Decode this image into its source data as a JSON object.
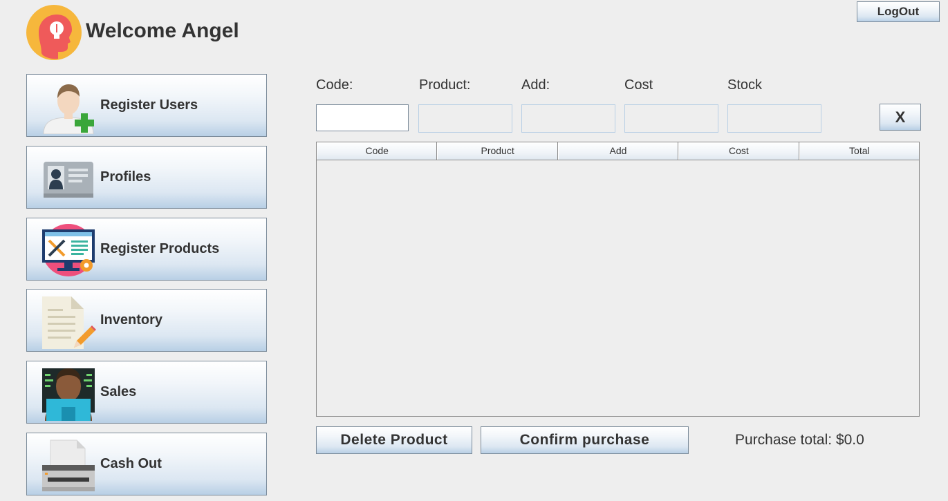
{
  "header": {
    "welcome": "Welcome Angel",
    "logout_label": "LogOut",
    "avatar_icon": "head-lightbulb-icon"
  },
  "sidebar": {
    "items": [
      {
        "label": "Register Users",
        "icon": "add-user-icon"
      },
      {
        "label": "Profiles",
        "icon": "id-card-icon"
      },
      {
        "label": "Register Products",
        "icon": "monitor-tools-icon"
      },
      {
        "label": "Inventory",
        "icon": "document-pencil-icon"
      },
      {
        "label": "Sales",
        "icon": "person-laptop-icon"
      },
      {
        "label": "Cash Out",
        "icon": "printer-icon"
      }
    ]
  },
  "form": {
    "fields": [
      {
        "label": "Code:",
        "value": ""
      },
      {
        "label": "Product:",
        "value": ""
      },
      {
        "label": "Add:",
        "value": ""
      },
      {
        "label": "Cost",
        "value": ""
      },
      {
        "label": "Stock",
        "value": ""
      }
    ],
    "clear_label": "X"
  },
  "table": {
    "columns": [
      "Code",
      "Product",
      "Add",
      "Cost",
      "Total"
    ],
    "rows": []
  },
  "actions": {
    "delete_label": "Delete Product",
    "confirm_label": "Confirm purchase",
    "total_text": "Purchase total: $0.0"
  },
  "colors": {
    "background": "#eeeeee",
    "button_gradient_bottom": "#b8cfe5",
    "text": "#333333"
  }
}
